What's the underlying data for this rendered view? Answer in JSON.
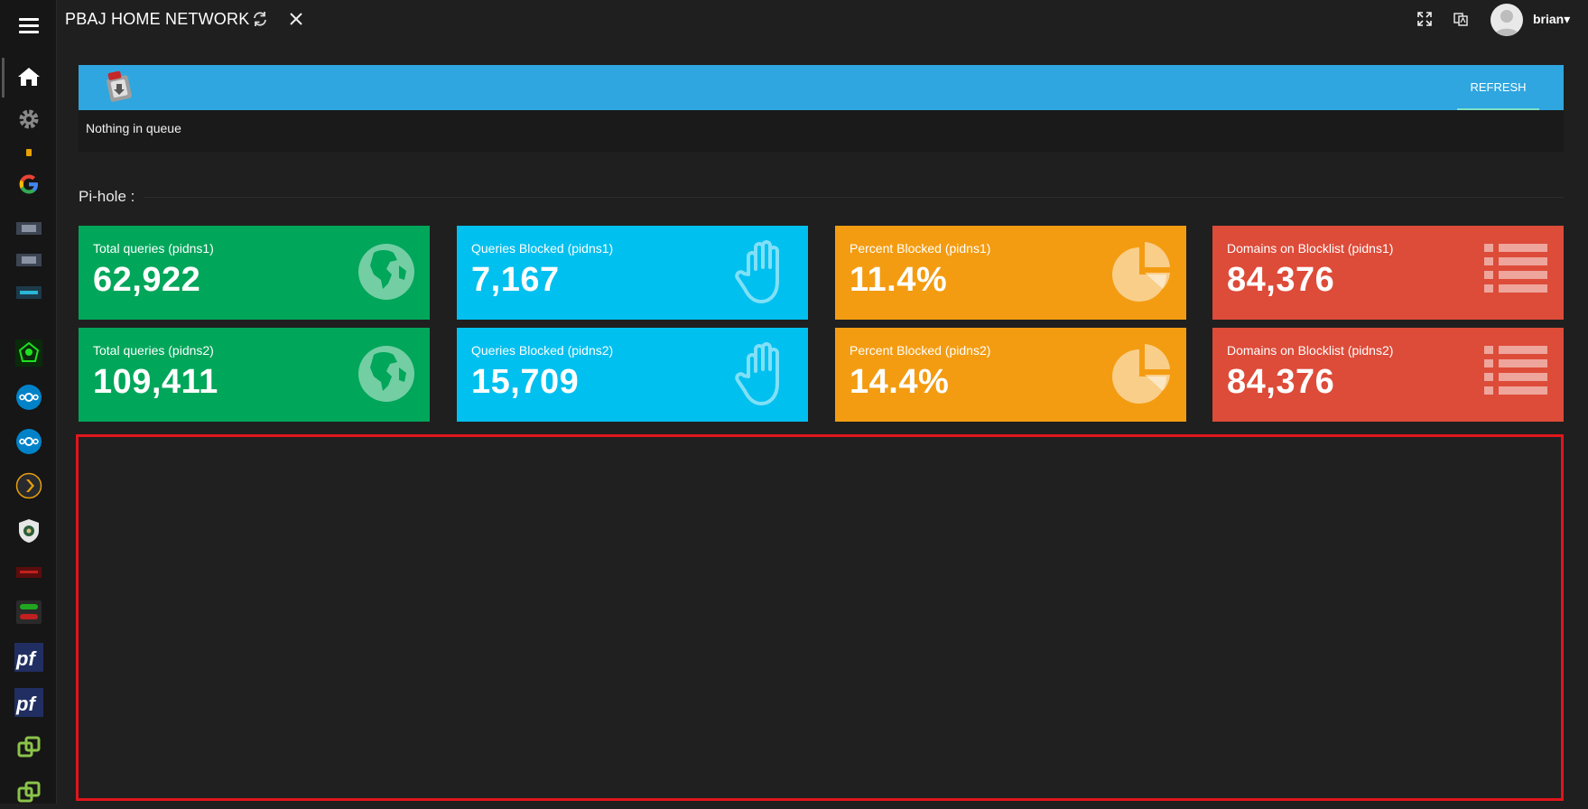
{
  "app": {
    "title": "PBAJ HOME NETWORK"
  },
  "user": {
    "name": "brian▾"
  },
  "sidebar": {
    "items": [
      {
        "name": "home"
      },
      {
        "name": "settings"
      },
      {
        "name": "app-1"
      },
      {
        "name": "google"
      },
      {
        "name": "app-2"
      },
      {
        "name": "app-3"
      },
      {
        "name": "app-4"
      },
      {
        "name": "app-5"
      },
      {
        "name": "nextcloud-1"
      },
      {
        "name": "nextcloud-2"
      },
      {
        "name": "plex"
      },
      {
        "name": "app-6"
      },
      {
        "name": "app-7"
      },
      {
        "name": "app-8"
      },
      {
        "name": "pfsense-1"
      },
      {
        "name": "pfsense-2"
      },
      {
        "name": "vmware-1"
      },
      {
        "name": "vmware-2"
      }
    ]
  },
  "queue": {
    "refresh_label": "REFRESH",
    "status": "Nothing in queue",
    "header_color": "#2fa6df"
  },
  "pihole": {
    "section_title": "Pi-hole :",
    "tiles": [
      {
        "label": "Total queries (pidns1)",
        "value": "62,922",
        "color": "#00a65a",
        "icon": "globe-icon"
      },
      {
        "label": "Queries Blocked (pidns1)",
        "value": "7,167",
        "color": "#00c0ef",
        "icon": "hand-icon"
      },
      {
        "label": "Percent Blocked (pidns1)",
        "value": "11.4%",
        "color": "#f39c12",
        "icon": "pie-chart-icon"
      },
      {
        "label": "Domains on Blocklist (pidns1)",
        "value": "84,376",
        "color": "#dd4b39",
        "icon": "list-icon"
      },
      {
        "label": "Total queries (pidns2)",
        "value": "109,411",
        "color": "#00a65a",
        "icon": "globe-icon"
      },
      {
        "label": "Queries Blocked (pidns2)",
        "value": "15,709",
        "color": "#00c0ef",
        "icon": "hand-icon"
      },
      {
        "label": "Percent Blocked (pidns2)",
        "value": "14.4%",
        "color": "#f39c12",
        "icon": "pie-chart-icon"
      },
      {
        "label": "Domains on Blocklist (pidns2)",
        "value": "84,376",
        "color": "#dd4b39",
        "icon": "list-icon"
      }
    ]
  },
  "accent_colors": {
    "frame_border": "#e0151c"
  }
}
